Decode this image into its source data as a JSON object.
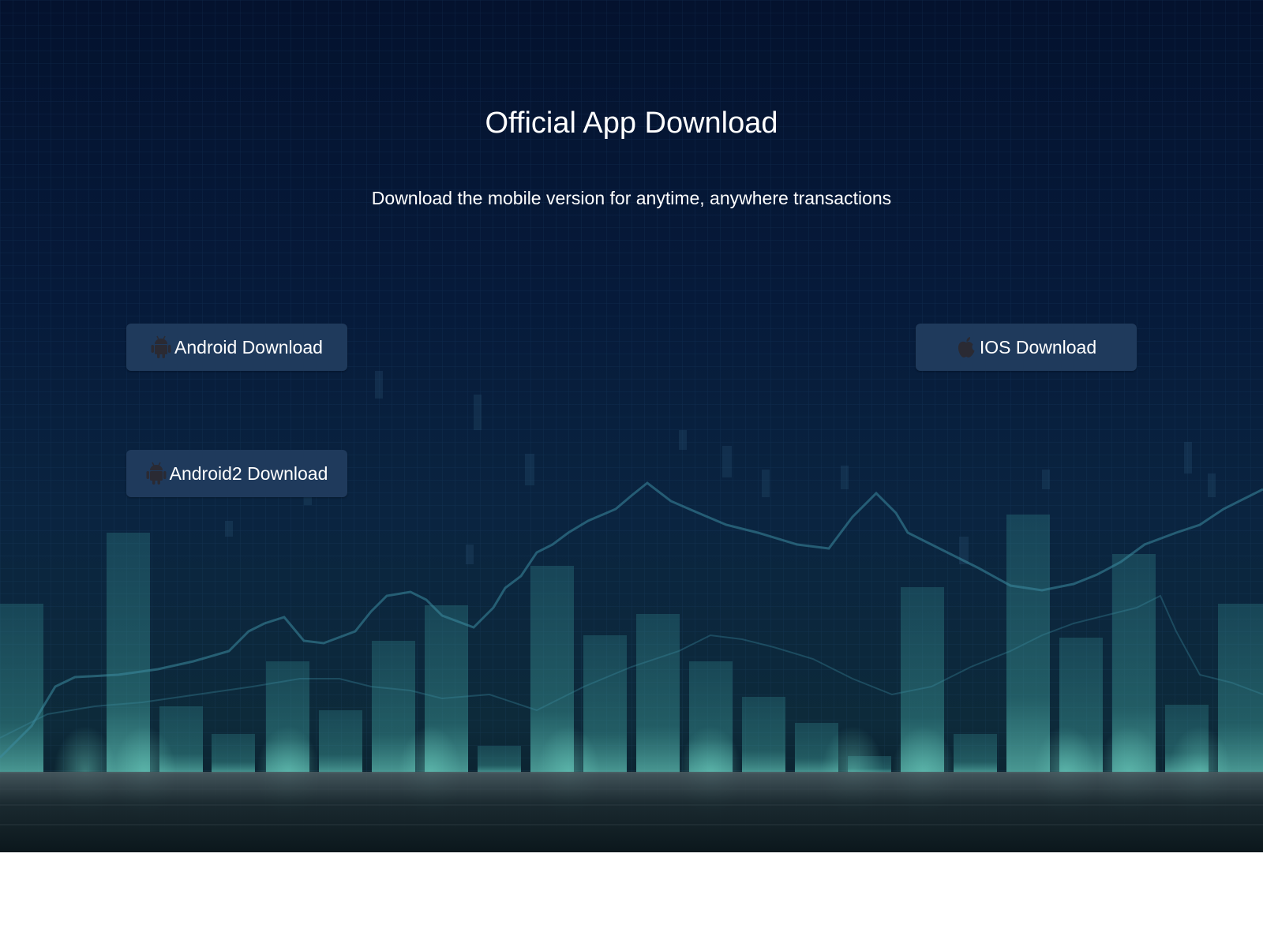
{
  "header": {
    "title": "Official App Download",
    "subtitle": "Download the mobile version for anytime, anywhere transactions"
  },
  "buttons": {
    "android": {
      "label": "Android Download",
      "icon": "android-icon"
    },
    "ios": {
      "label": "IOS Download",
      "icon": "apple-icon"
    },
    "android2": {
      "label": "Android2 Download",
      "icon": "android-icon"
    }
  },
  "colors": {
    "background": "#061a3a",
    "button": "#1f3a5c",
    "text": "#ffffff",
    "icon": "#2a2a33"
  }
}
